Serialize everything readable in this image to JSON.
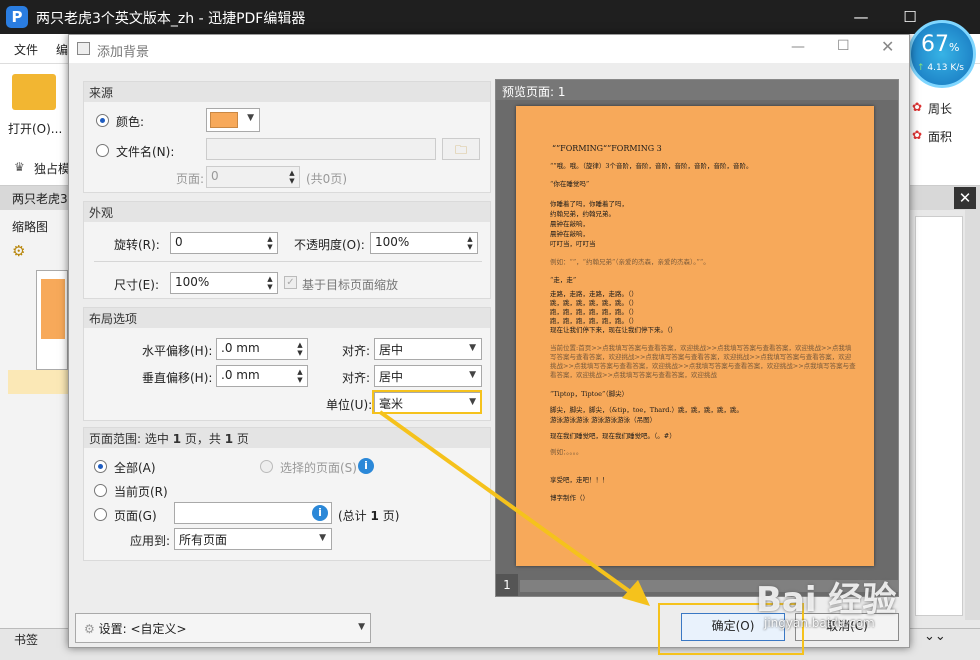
{
  "app": {
    "logo": "P",
    "title": "两只老虎3个英文版本_zh - 迅捷PDF编辑器",
    "menu": [
      "文件",
      "编"
    ],
    "open_label": "打开(O)...",
    "exclusive_label": "独占模",
    "doc_tab": "两只老虎3",
    "thumb_header": "缩略图",
    "bookmarks_label": "书签",
    "right_tools": [
      "周长",
      "面积"
    ]
  },
  "network_widget": {
    "percent": "67",
    "unit": "%",
    "speed": "4.13 K/s"
  },
  "dialog": {
    "title": "添加背景",
    "source": {
      "heading": "来源",
      "color_label": "颜色:",
      "color_value": "#f7a95a",
      "file_label": "文件名(N):",
      "file_value": "",
      "page_label": "页面:",
      "page_value": "0",
      "page_total": "(共0页)"
    },
    "appearance": {
      "heading": "外观",
      "rotate_label": "旋转(R):",
      "rotate_value": "0",
      "opacity_label": "不透明度(O):",
      "opacity_value": "100%",
      "size_label": "尺寸(E):",
      "size_value": "100%",
      "scale_label": "基于目标页面缩放"
    },
    "layout": {
      "heading": "布局选项",
      "h_offset_label": "水平偏移(H):",
      "h_offset_value": ".0 mm",
      "v_offset_label": "垂直偏移(H):",
      "v_offset_value": ".0 mm",
      "align_label": "对齐:",
      "h_align_value": "居中",
      "v_align_value": "居中",
      "unit_label": "单位(U):",
      "unit_value": "毫米"
    },
    "page_range": {
      "heading_prefix": "页面范围: 选中",
      "heading_count": "1",
      "heading_mid": "页，共",
      "heading_total": "1",
      "heading_suffix": "页",
      "all_label": "全部(A)",
      "selected_label": "选择的页面(S)",
      "current_label": "当前页(R)",
      "pages_label": "页面(G)",
      "pages_value": "",
      "total_prefix": "(总计",
      "total_count": "1",
      "total_suffix": "页)",
      "apply_label": "应用到:",
      "apply_value": "所有页面"
    },
    "preview": {
      "heading": "预览页面: 1",
      "page_number": "1",
      "lines": [
        "“”FORMING“”FORMING 3",
        "“”哦。哦。（旋律）3个音阶，音阶，音阶，音阶，音阶，音阶，音阶。",
        "“你在睡觉吗”",
        "你睡着了吗，你睡着了吗，",
        "约翰兄弟，约翰兄弟。",
        "晨钟在敲响，",
        "晨钟在敲响，",
        "叮叮当，叮叮当",
        "例如：“”，“约翰兄弟”（亲爱的杰森，亲爱的杰森）。”“。",
        "“走，走”",
        "走路，走路，走路，走路。（）",
        "跳，跳，跳，跳，跳，跳。（）",
        "跑，跑，跑，跑，跑，跑。（）",
        "跑，跑，跑，跑，跑，跑。（）",
        "现在让我们停下来，现在让我们停下来。（）",
        "当前位置:首页>>点我填写答案与查看答案，欢迎挑战>>点我填写答案与查看答案，欢迎挑战>>点我填",
        "写答案与查看答案，欢迎挑战>>点我填写答案与查看答案，欢迎挑战>>点我填写答案与查看答案，欢迎",
        "挑战>>点我填写答案与查看答案，欢迎挑战>>点我填写答案与查看答案，欢迎挑战>>点我填写答案与查",
        "看答案，欢迎挑战>>点我填写答案与查看答案，欢迎挑战",
        "“Tiptop，Tiptoe”（脚尖）",
        "脚尖，脚尖，脚尖，（&tip，toe，Thard.）跳，跳，跳，跳，跳。",
        "游泳游泳游泳 游泳游泳游泳（吊图）",
        "现在我们睡觉吧，现在我们睡觉吧。（。#）",
        "例如：。。。。",
        "享受吧，走吧！！！",
        "博字制作（）"
      ]
    },
    "settings_label": "设置:",
    "settings_value": "<自定义>",
    "ok_label": "确定(O)",
    "cancel_label": "取消(C)"
  },
  "watermark": {
    "text": "Bai 经验",
    "url": "jingyan.baidu.com"
  }
}
